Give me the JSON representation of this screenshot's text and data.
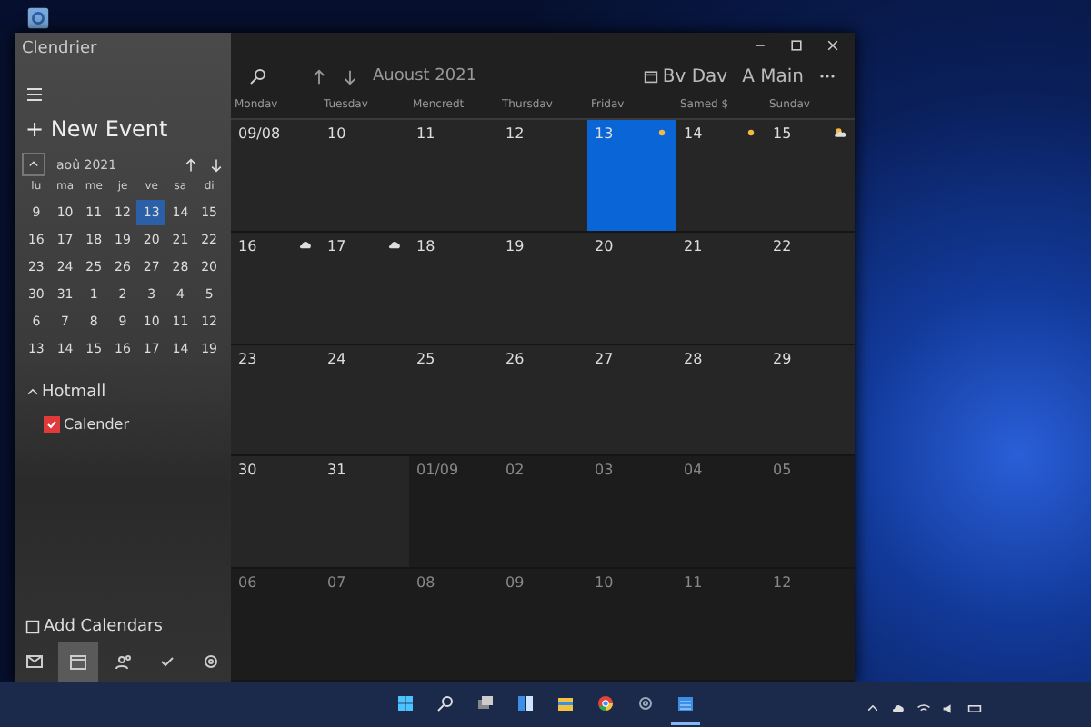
{
  "window": {
    "title": "Clendrier"
  },
  "sidebar": {
    "new_event": "+ New Event",
    "mini_calendar": {
      "month": "aoû 2021",
      "weekdays": [
        "lu",
        "ma",
        "me",
        "je",
        "ve",
        "sa",
        "di"
      ],
      "weeks": [
        [
          {
            "day": "9",
            "selected": false
          },
          {
            "day": "10",
            "selected": false
          },
          {
            "day": "11",
            "selected": false
          },
          {
            "day": "12",
            "selected": false
          },
          {
            "day": "13",
            "selected": true
          },
          {
            "day": "14",
            "selected": false
          },
          {
            "day": "15",
            "selected": false
          }
        ],
        [
          {
            "day": "16",
            "selected": false
          },
          {
            "day": "17",
            "selected": false
          },
          {
            "day": "18",
            "selected": false
          },
          {
            "day": "19",
            "selected": false
          },
          {
            "day": "20",
            "selected": false
          },
          {
            "day": "21",
            "selected": false
          },
          {
            "day": "22",
            "selected": false
          }
        ],
        [
          {
            "day": "23",
            "selected": false
          },
          {
            "day": "24",
            "selected": false
          },
          {
            "day": "25",
            "selected": false
          },
          {
            "day": "26",
            "selected": false
          },
          {
            "day": "27",
            "selected": false
          },
          {
            "day": "28",
            "selected": false
          },
          {
            "day": "20",
            "selected": false
          }
        ],
        [
          {
            "day": "30",
            "selected": false
          },
          {
            "day": "31",
            "selected": false
          },
          {
            "day": "1",
            "selected": false
          },
          {
            "day": "2",
            "selected": false
          },
          {
            "day": "3",
            "selected": false
          },
          {
            "day": "4",
            "selected": false
          },
          {
            "day": "5",
            "selected": false
          }
        ],
        [
          {
            "day": "6",
            "selected": false
          },
          {
            "day": "7",
            "selected": false
          },
          {
            "day": "8",
            "selected": false
          },
          {
            "day": "9",
            "selected": false
          },
          {
            "day": "10",
            "selected": false
          },
          {
            "day": "11",
            "selected": false
          },
          {
            "day": "12",
            "selected": false
          }
        ],
        [
          {
            "day": "13",
            "selected": false
          },
          {
            "day": "14",
            "selected": false
          },
          {
            "day": "15",
            "selected": false
          },
          {
            "day": "16",
            "selected": false
          },
          {
            "day": "17",
            "selected": false
          },
          {
            "day": "14",
            "selected": false
          },
          {
            "day": "19",
            "selected": false
          }
        ]
      ]
    },
    "account": "Hotmall",
    "calendars": [
      {
        "name": "Calender",
        "checked": true,
        "color": "#e03a3a"
      }
    ],
    "add_calendars": "Add Calendars",
    "nav": [
      {
        "kind": "mail",
        "selected": false
      },
      {
        "kind": "calendar",
        "selected": true
      },
      {
        "kind": "people",
        "selected": false
      },
      {
        "kind": "todo",
        "selected": false
      },
      {
        "kind": "settings",
        "selected": false
      }
    ]
  },
  "toolbar": {
    "month": "Auoust 2021",
    "view": "Bv Dav",
    "view_2": "A Main"
  },
  "columns": [
    "Mondav",
    "Tuesdav",
    "Mencredt",
    "Thursdav",
    "Fridav",
    "Samed $",
    "Sundav"
  ],
  "weeks": [
    [
      {
        "day": "09/08",
        "in_month": true,
        "selected": false
      },
      {
        "day": "10",
        "in_month": true,
        "selected": false
      },
      {
        "day": "11",
        "in_month": true,
        "selected": false
      },
      {
        "day": "12",
        "in_month": true,
        "selected": false
      },
      {
        "day": "13",
        "in_month": true,
        "selected": true,
        "weather": {
          "kind": "sun"
        }
      },
      {
        "day": "14",
        "in_month": true,
        "selected": false,
        "weather": {
          "kind": "sun"
        }
      },
      {
        "day": "15",
        "in_month": true,
        "selected": false,
        "weather": {
          "kind": "partly"
        }
      }
    ],
    [
      {
        "day": "16",
        "in_month": true,
        "selected": false,
        "weather": {
          "kind": "cloud"
        }
      },
      {
        "day": "17",
        "in_month": true,
        "selected": false,
        "weather": {
          "kind": "cloud"
        }
      },
      {
        "day": "18",
        "in_month": true,
        "selected": false
      },
      {
        "day": "19",
        "in_month": true,
        "selected": false
      },
      {
        "day": "20",
        "in_month": true,
        "selected": false
      },
      {
        "day": "21",
        "in_month": true,
        "selected": false
      },
      {
        "day": "22",
        "in_month": true,
        "selected": false
      }
    ],
    [
      {
        "day": "23",
        "in_month": true,
        "selected": false
      },
      {
        "day": "24",
        "in_month": true,
        "selected": false
      },
      {
        "day": "25",
        "in_month": true,
        "selected": false
      },
      {
        "day": "26",
        "in_month": true,
        "selected": false
      },
      {
        "day": "27",
        "in_month": true,
        "selected": false
      },
      {
        "day": "28",
        "in_month": true,
        "selected": false
      },
      {
        "day": "29",
        "in_month": true,
        "selected": false
      }
    ],
    [
      {
        "day": "30",
        "in_month": true,
        "selected": false
      },
      {
        "day": "31",
        "in_month": true,
        "selected": false
      },
      {
        "day": "01/09",
        "in_month": false,
        "selected": false
      },
      {
        "day": "02",
        "in_month": false,
        "selected": false
      },
      {
        "day": "03",
        "in_month": false,
        "selected": false
      },
      {
        "day": "04",
        "in_month": false,
        "selected": false
      },
      {
        "day": "05",
        "in_month": false,
        "selected": false
      }
    ],
    [
      {
        "day": "06",
        "in_month": false,
        "selected": false
      },
      {
        "day": "07",
        "in_month": false,
        "selected": false
      },
      {
        "day": "08",
        "in_month": false,
        "selected": false
      },
      {
        "day": "09",
        "in_month": false,
        "selected": false
      },
      {
        "day": "10",
        "in_month": false,
        "selected": false
      },
      {
        "day": "11",
        "in_month": false,
        "selected": false
      },
      {
        "day": "12",
        "in_month": false,
        "selected": false
      }
    ]
  ],
  "taskbar": [
    {
      "kind": "start",
      "active": false
    },
    {
      "kind": "search",
      "active": false
    },
    {
      "kind": "taskview",
      "active": false
    },
    {
      "kind": "widgets",
      "active": false
    },
    {
      "kind": "folder",
      "active": false
    },
    {
      "kind": "browser",
      "active": false
    },
    {
      "kind": "settings",
      "active": false
    },
    {
      "kind": "calendar",
      "active": true
    }
  ]
}
